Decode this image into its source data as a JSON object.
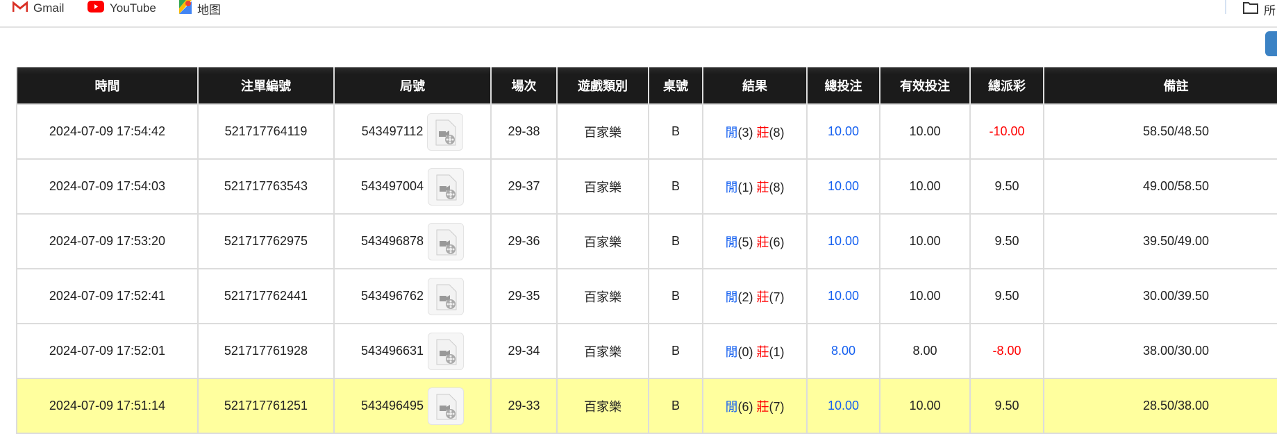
{
  "bookmarks": [
    {
      "label": "Gmail",
      "icon": "gmail-icon"
    },
    {
      "label": "YouTube",
      "icon": "youtube-icon"
    },
    {
      "label": "地图",
      "icon": "maps-icon"
    }
  ],
  "bookmarks_folder": {
    "label": "所",
    "icon": "folder-icon"
  },
  "table": {
    "headers": [
      "時間",
      "注單編號",
      "局號",
      "場次",
      "遊戲類別",
      "桌號",
      "結果",
      "總投注",
      "有效投注",
      "總派彩",
      "備註"
    ],
    "rows": [
      {
        "time": "2024-07-09 17:54:42",
        "bet_id": "521717764119",
        "round": "543497112",
        "shoe": "29-38",
        "game": "百家樂",
        "table": "B",
        "player_label": "閒",
        "player": "(3)",
        "banker_label": "莊",
        "banker": "(8)",
        "total": "10.00",
        "valid": "10.00",
        "payout": "-10.00",
        "payout_negative": true,
        "note": "58.50/48.50"
      },
      {
        "time": "2024-07-09 17:54:03",
        "bet_id": "521717763543",
        "round": "543497004",
        "shoe": "29-37",
        "game": "百家樂",
        "table": "B",
        "player_label": "閒",
        "player": "(1)",
        "banker_label": "莊",
        "banker": "(8)",
        "total": "10.00",
        "valid": "10.00",
        "payout": "9.50",
        "payout_negative": false,
        "note": "49.00/58.50"
      },
      {
        "time": "2024-07-09 17:53:20",
        "bet_id": "521717762975",
        "round": "543496878",
        "shoe": "29-36",
        "game": "百家樂",
        "table": "B",
        "player_label": "閒",
        "player": "(5)",
        "banker_label": "莊",
        "banker": "(6)",
        "total": "10.00",
        "valid": "10.00",
        "payout": "9.50",
        "payout_negative": false,
        "note": "39.50/49.00"
      },
      {
        "time": "2024-07-09 17:52:41",
        "bet_id": "521717762441",
        "round": "543496762",
        "shoe": "29-35",
        "game": "百家樂",
        "table": "B",
        "player_label": "閒",
        "player": "(2)",
        "banker_label": "莊",
        "banker": "(7)",
        "total": "10.00",
        "valid": "10.00",
        "payout": "9.50",
        "payout_negative": false,
        "note": "30.00/39.50"
      },
      {
        "time": "2024-07-09 17:52:01",
        "bet_id": "521717761928",
        "round": "543496631",
        "shoe": "29-34",
        "game": "百家樂",
        "table": "B",
        "player_label": "閒",
        "player": "(0)",
        "banker_label": "莊",
        "banker": "(1)",
        "total": "8.00",
        "valid": "8.00",
        "payout": "-8.00",
        "payout_negative": true,
        "note": "38.00/30.00"
      },
      {
        "time": "2024-07-09 17:51:14",
        "bet_id": "521717761251",
        "round": "543496495",
        "shoe": "29-33",
        "game": "百家樂",
        "table": "B",
        "player_label": "閒",
        "player": "(6)",
        "banker_label": "莊",
        "banker": "(7)",
        "total": "10.00",
        "valid": "10.00",
        "payout": "9.50",
        "payout_negative": false,
        "note": "28.50/38.00",
        "highlighted": true
      }
    ]
  },
  "colors": {
    "header_bg": "#1b1b1b",
    "highlight_row": "#ffff9e",
    "player": "#1560f0",
    "banker": "#ff0000",
    "negative": "#ff0000"
  }
}
